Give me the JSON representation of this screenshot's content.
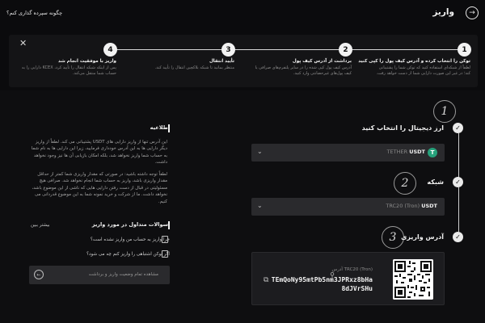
{
  "header": {
    "title": "واریز",
    "back_icon": "arrow-right-icon",
    "help_link": "چگونه سپرده گذاری کنم؟"
  },
  "steps": [
    {
      "number": "1",
      "title": "توکن را انتخاب کرده و آدرس کیف پول را کپی کنید",
      "desc": "لطفاً از شبکه‌ای استفاده کنید که توکن شما را پشتیبانی کند؛ در غیر این صورت دارایی شما از دست خواهد رفت."
    },
    {
      "number": "2",
      "title": "برداشت از آدرس کیف پول",
      "desc": "آدرس کیف پول کپی شده را در سایر پلتفرم‌های صرافی یا کیف پول‌های غیرحضانتی وارد کنید."
    },
    {
      "number": "3",
      "title": "تأیید انتقال",
      "desc": "منتظر بمانید تا شبکه بلاکچین انتقال را تأیید کند."
    },
    {
      "number": "4",
      "title": "واریز با موفقیت انجام شد",
      "desc": "پس از اینکه شبکه انتقال را تأیید کرد، KCEX دارایی را به حساب شما منتقل می‌کند."
    }
  ],
  "sections": {
    "coin": {
      "number": "1",
      "label": "ارز دیجیتال را انتخاب کنید",
      "symbol": "USDT",
      "name": "TETHER",
      "icon": "tether-icon",
      "icon_color": "#26a17b"
    },
    "network": {
      "number": "2",
      "label": "شبکه",
      "symbol": "USDT",
      "network": "TRC20 (Tron)"
    },
    "address": {
      "number": "3",
      "label": "آدرس واریزی",
      "network_label": "TRC20 (Tron)",
      "address_caption": "آدرس",
      "address_line1": "TEmQoNy95mtPb5nm3JPRxz8bHa",
      "address_line2": "8dJVrSHu"
    }
  },
  "notice": {
    "title": "اطلاعیه",
    "p1": "این آدرس تنها از واریز دارایی های USDT پشتیبانی می کند. لطفاً از واریز دیگر دارایی ها به این آدرس خودداری فرمایید، زیرا این دارایی ها به نام شما به حساب شما واریز نخواهد شد، بلکه امکان بازیابی آن ها نیز وجود نخواهد داشت.",
    "p2": "لطفاً توجه داشته باشید: در صورتی که مقدار واریزی شما کمتر از حداقل مقدار واریزی باشد، واریز به حساب شما انجام نخواهد شد. صرافی هیچ مسئولیتی در قبال از دست رفتن دارایی هایی که ناشی از این موضوع باشد، نخواهد داشت. ما از شرکت و خرید نمونه شما به این موضوع قدردانی می کنیم."
  },
  "faq": {
    "title": "سوالات متداول در مورد واریز",
    "more": "بیشتر ببین",
    "items": [
      "چرا واریز به حساب من واریز نشده است؟",
      "اگر توکن اشتباهی را واریز کنم چه می شود؟"
    ],
    "search_placeholder": "مشاهده تمام وضعیت واریز و برداشت"
  }
}
